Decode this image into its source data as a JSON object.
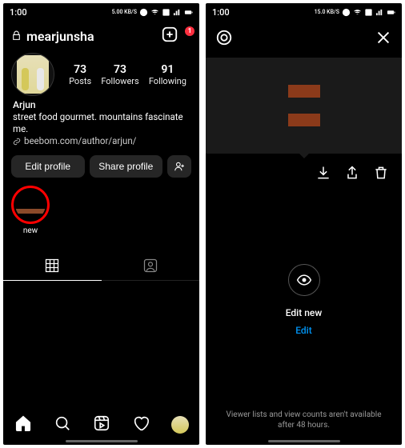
{
  "left": {
    "status": {
      "time": "1:00",
      "net": "5.00\nKB/S"
    },
    "handle": "mearjunsha",
    "badge": "1",
    "stats": {
      "posts": {
        "num": "73",
        "label": "Posts"
      },
      "followers": {
        "num": "73",
        "label": "Followers"
      },
      "following": {
        "num": "91",
        "label": "Following"
      }
    },
    "bio": {
      "name": "Arjun",
      "line": "street food gourmet. mountains fascinate me.",
      "link": "beebom.com/author/arjun/"
    },
    "buttons": {
      "edit": "Edit profile",
      "share": "Share profile"
    },
    "highlight": {
      "label": "new"
    }
  },
  "right": {
    "status": {
      "time": "1:00",
      "net": "15.0\nKB/S"
    },
    "edit_title": "Edit new",
    "edit_link": "Edit",
    "footer": "Viewer lists and view counts aren't available after 48 hours."
  }
}
